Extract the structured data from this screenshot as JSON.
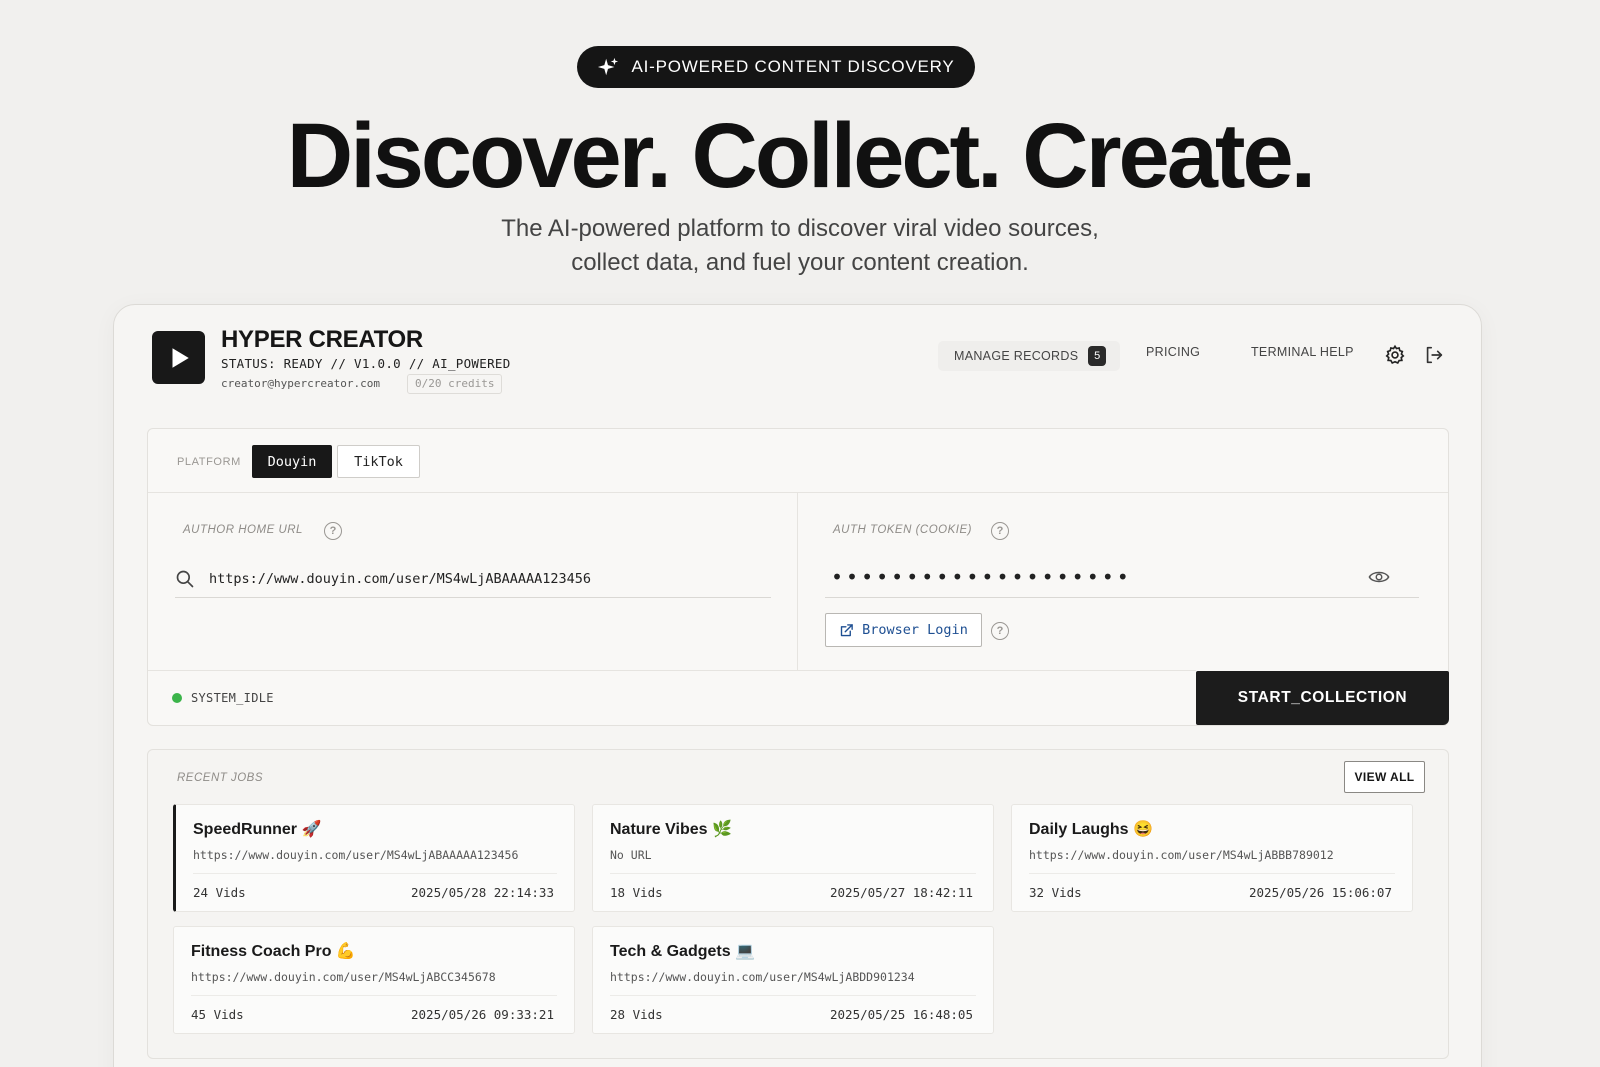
{
  "hero": {
    "pill_text": "AI-POWERED CONTENT DISCOVERY",
    "headline": "Discover. Collect. Create.",
    "sub_line1": "The AI-powered platform to discover viral video sources,",
    "sub_line2": "collect data, and fuel your content creation."
  },
  "header": {
    "title": "HYPER CREATOR",
    "status": "STATUS: READY // V1.0.0 // AI_POWERED",
    "email": "creator@hypercreator.com",
    "credits": "0/20 credits",
    "nav": {
      "manage_records": "MANAGE RECORDS",
      "manage_count": "5",
      "pricing": "PRICING",
      "terminal_help": "TERMINAL HELP"
    },
    "icons": [
      "gear-icon",
      "logout-icon"
    ]
  },
  "form": {
    "platform_label": "PLATFORM",
    "platforms": [
      "Douyin",
      "TikTok"
    ],
    "active_platform": "Douyin",
    "author_url_label": "AUTHOR HOME URL",
    "author_url_value": "https://www.douyin.com/user/MS4wLjABAAAAA123456",
    "auth_token_label": "AUTH TOKEN (COOKIE)",
    "auth_token_value": "••••••••••••••••••••",
    "browser_login_label": "Browser Login",
    "status_text": "SYSTEM_IDLE",
    "status_color": "#3bb44a",
    "start_button": "START_COLLECTION"
  },
  "jobs": {
    "label": "RECENT JOBS",
    "view_all": "VIEW ALL",
    "items": [
      {
        "title": "SpeedRunner 🚀",
        "url": "https://www.douyin.com/user/MS4wLjABAAAAA123456",
        "vids": "24 Vids",
        "date": "2025/05/28 22:14:33"
      },
      {
        "title": "Nature Vibes 🌿",
        "url": "No URL",
        "vids": "18 Vids",
        "date": "2025/05/27 18:42:11"
      },
      {
        "title": "Daily Laughs 😆",
        "url": "https://www.douyin.com/user/MS4wLjABBB789012",
        "vids": "32 Vids",
        "date": "2025/05/26 15:06:07"
      },
      {
        "title": "Fitness Coach Pro 💪",
        "url": "https://www.douyin.com/user/MS4wLjABCC345678",
        "vids": "45 Vids",
        "date": "2025/05/26 09:33:21"
      },
      {
        "title": "Tech & Gadgets 💻",
        "url": "https://www.douyin.com/user/MS4wLjABDD901234",
        "vids": "28 Vids",
        "date": "2025/05/25 16:48:05"
      }
    ]
  }
}
